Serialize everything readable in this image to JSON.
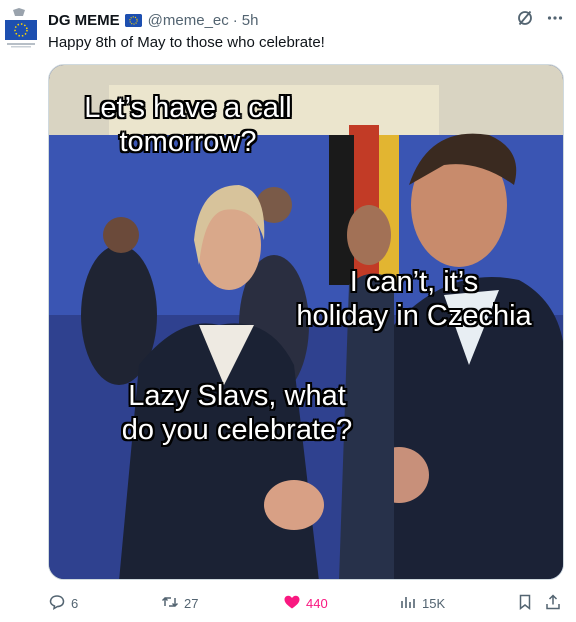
{
  "tweet": {
    "author_name": "DG MEME",
    "handle": "@meme_ec",
    "separator": "·",
    "time": "5h",
    "text": "Happy 8th of May to those who celebrate!"
  },
  "meme": {
    "caption_top": "Let’s have a call\ntomorrow?",
    "caption_right": "I can’t, it’s\nholiday in Czechia",
    "caption_bottom": "Lazy Slavs, what\ndo you celebrate?"
  },
  "actions": {
    "replies": "6",
    "reposts": "27",
    "likes": "440",
    "views": "15K"
  },
  "colors": {
    "accent_like": "#f91880",
    "text_secondary": "#536471",
    "eu_blue": "#1d4fb0",
    "eu_star": "#ffd700"
  },
  "icons": [
    "grok-icon",
    "more-icon",
    "reply-icon",
    "repost-icon",
    "like-icon",
    "views-icon",
    "bookmark-icon",
    "share-icon"
  ]
}
